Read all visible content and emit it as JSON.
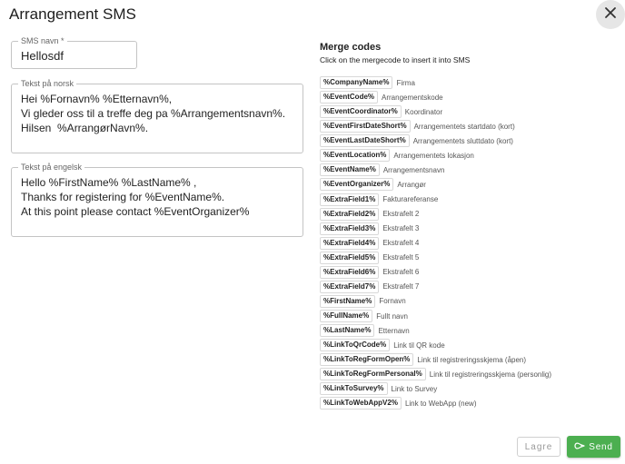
{
  "dialog": {
    "title": "Arrangement SMS",
    "close_icon": "close-icon"
  },
  "form": {
    "sms_name": {
      "label": "SMS navn *",
      "value": "Hellosdf"
    },
    "text_no": {
      "label": "Tekst på norsk",
      "value": "Hei %Fornavn% %Etternavn%,\nVi gleder oss til a treffe deg pa %Arrangementsnavn%.\nHilsen  %ArrangørNavn%."
    },
    "text_en": {
      "label": "Tekst på engelsk",
      "value": "Hello %FirstName% %LastName% ,\nThanks for registering for %EventName%.\nAt this point please contact %EventOrganizer%"
    }
  },
  "merge": {
    "title": "Merge codes",
    "subtitle": "Click on the mergecode to insert it into SMS",
    "codes": [
      {
        "code": "%CompanyName%",
        "desc": "Firma"
      },
      {
        "code": "%EventCode%",
        "desc": "Arrangementskode"
      },
      {
        "code": "%EventCoordinator%",
        "desc": "Koordinator"
      },
      {
        "code": "%EventFirstDateShort%",
        "desc": "Arrangementets startdato (kort)"
      },
      {
        "code": "%EventLastDateShort%",
        "desc": "Arrangementets sluttdato (kort)"
      },
      {
        "code": "%EventLocation%",
        "desc": "Arrangementets lokasjon"
      },
      {
        "code": "%EventName%",
        "desc": "Arrangementsnavn"
      },
      {
        "code": "%EventOrganizer%",
        "desc": "Arrangør"
      },
      {
        "code": "%ExtraField1%",
        "desc": "Fakturareferanse"
      },
      {
        "code": "%ExtraField2%",
        "desc": "Ekstrafelt 2"
      },
      {
        "code": "%ExtraField3%",
        "desc": "Ekstrafelt 3"
      },
      {
        "code": "%ExtraField4%",
        "desc": "Ekstrafelt 4"
      },
      {
        "code": "%ExtraField5%",
        "desc": "Ekstrafelt 5"
      },
      {
        "code": "%ExtraField6%",
        "desc": "Ekstrafelt 6"
      },
      {
        "code": "%ExtraField7%",
        "desc": "Ekstrafelt 7"
      },
      {
        "code": "%FirstName%",
        "desc": "Fornavn"
      },
      {
        "code": "%FullName%",
        "desc": "Fullt navn"
      },
      {
        "code": "%LastName%",
        "desc": "Etternavn"
      },
      {
        "code": "%LinkToQrCode%",
        "desc": "Link til QR kode"
      },
      {
        "code": "%LinkToRegFormOpen%",
        "desc": "Link til registreringsskjema (åpen)"
      },
      {
        "code": "%LinkToRegFormPersonal%",
        "desc": "Link til registreringsskjema (personlig)"
      },
      {
        "code": "%LinkToSurvey%",
        "desc": "Link to Survey"
      },
      {
        "code": "%LinkToWebAppV2%",
        "desc": "Link to WebApp (new)"
      }
    ]
  },
  "actions": {
    "save_label": "Lagre",
    "send_label": "Send",
    "send_icon": "send-icon"
  },
  "colors": {
    "accent": "#4caf50",
    "close_bg": "#e6e6e6",
    "border": "#c4c4c4"
  }
}
